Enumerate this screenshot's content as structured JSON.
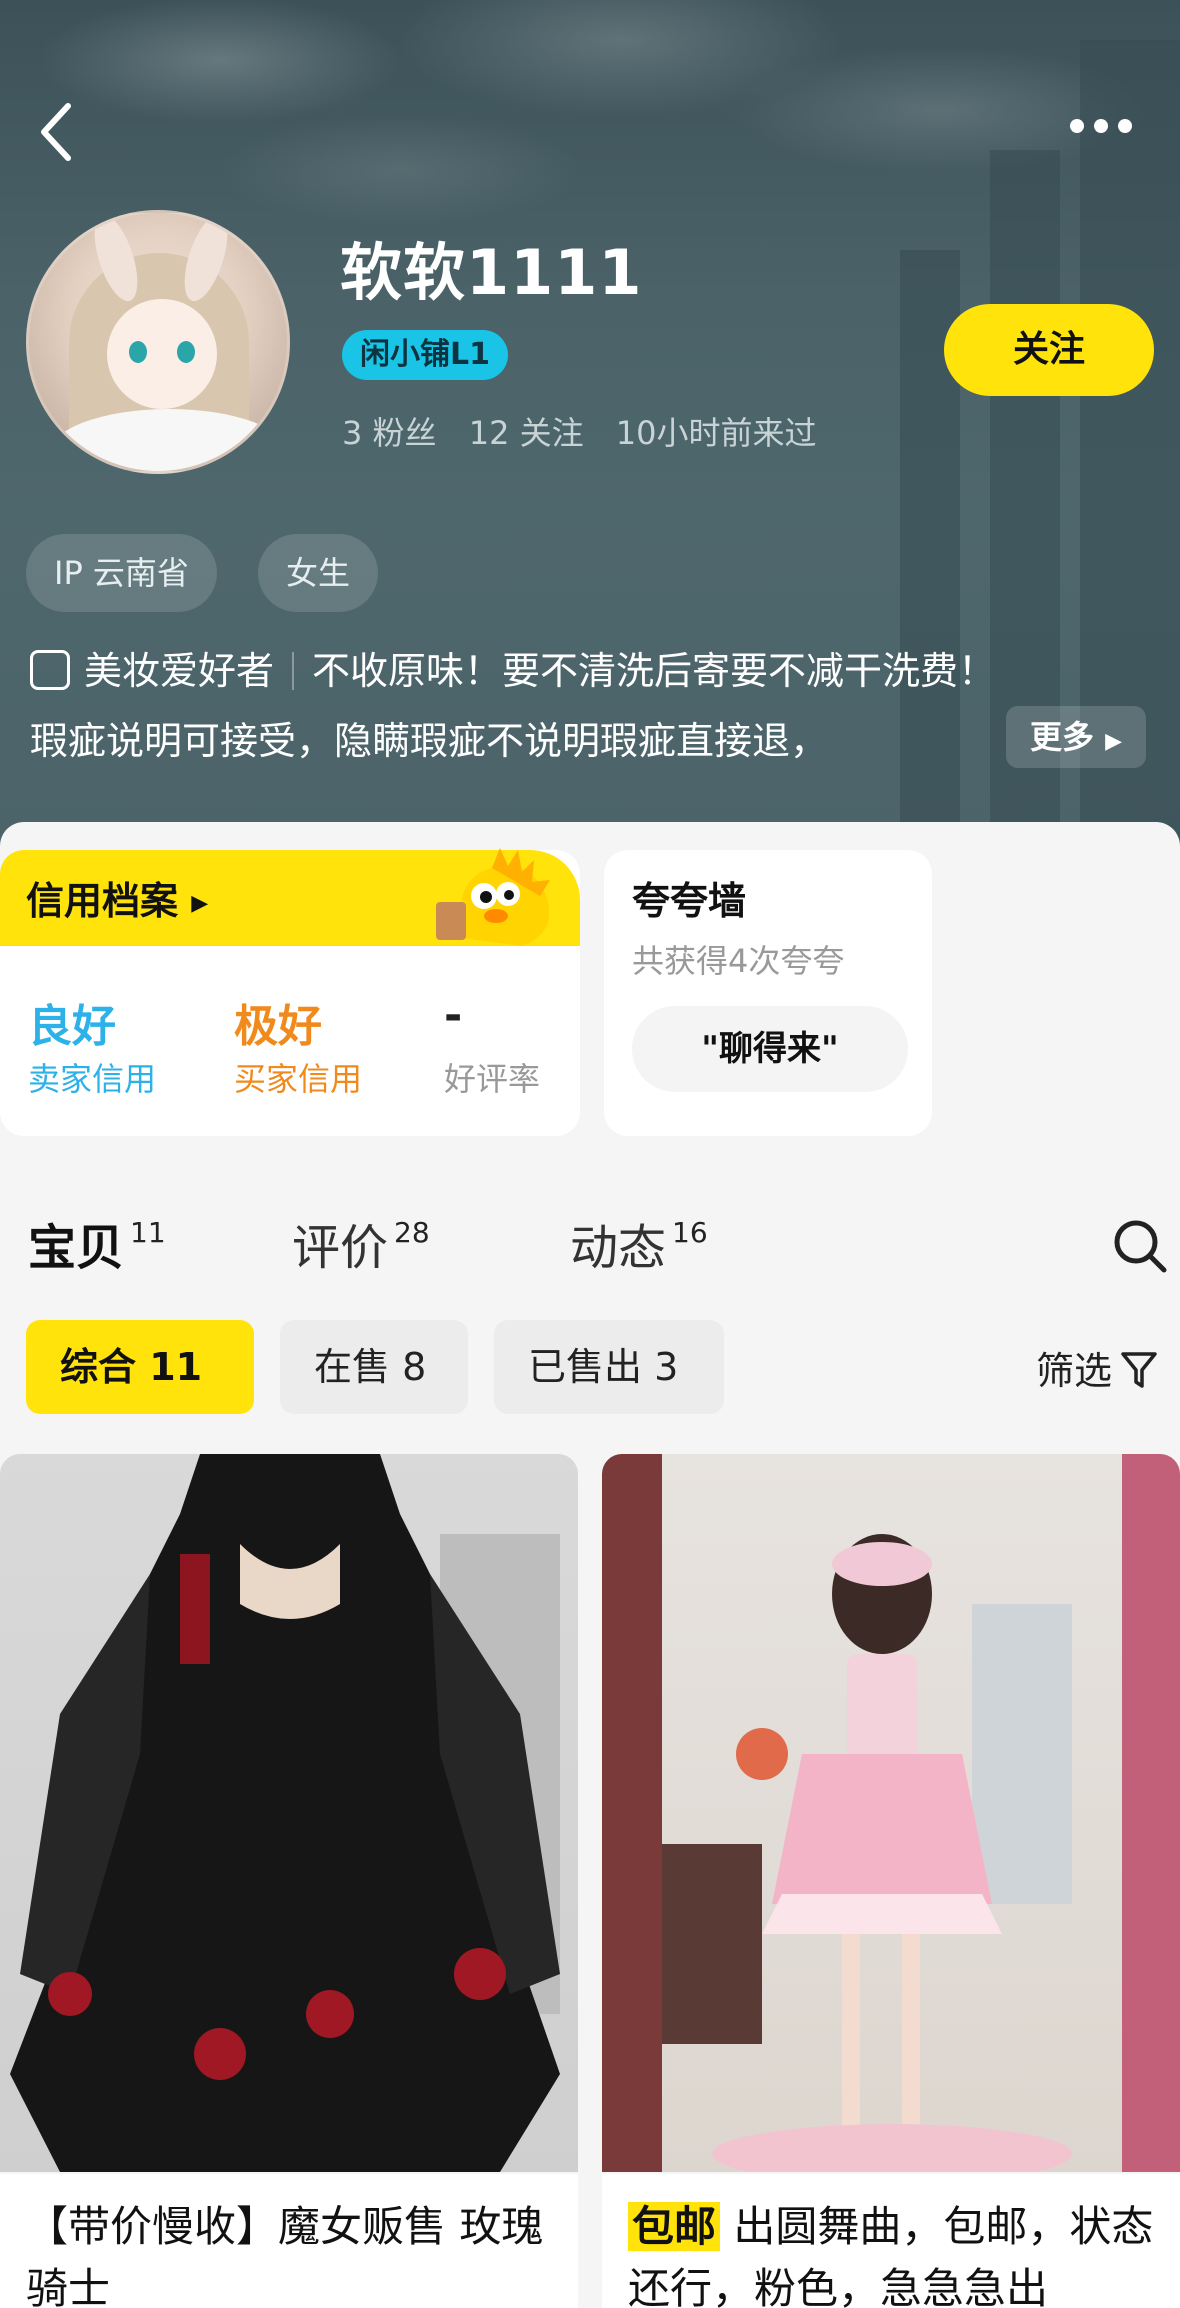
{
  "header": {
    "username": "软软1111",
    "level_badge": "闲小铺L1",
    "followers": "3 粉丝",
    "following": "12 关注",
    "last_seen": "10小时前来过",
    "follow_label": "关注",
    "tags": [
      "IP 云南省",
      "女生"
    ],
    "bio_category": "美妆爱好者",
    "bio_line1": "不收原味！要不清洗后寄要不减干洗费！",
    "bio_line2": "瑕疵说明可接受，隐瞒瑕疵不说明瑕疵直接退，",
    "more_label": "更多"
  },
  "credit": {
    "title": "信用档案",
    "items": [
      {
        "value": "良好",
        "label": "卖家信用",
        "color": "#2cb1e8"
      },
      {
        "value": "极好",
        "label": "买家信用",
        "color": "#f08a1c"
      },
      {
        "value": "-",
        "label": "好评率",
        "color": "#999999"
      }
    ]
  },
  "praise": {
    "title": "夸夸墙",
    "subtitle": "共获得4次夸夸",
    "chip": "\"聊得来\""
  },
  "tabs": [
    {
      "label": "宝贝",
      "count": "11"
    },
    {
      "label": "评价",
      "count": "28"
    },
    {
      "label": "动态",
      "count": "16"
    }
  ],
  "filters": {
    "chips": [
      "综合 11",
      "在售 8",
      "已售出 3"
    ],
    "filter_label": "筛选"
  },
  "products": [
    {
      "caption": "【带价慢收】魔女贩售 玫瑰骑士"
    },
    {
      "tag": "包邮",
      "caption": "出圆舞曲，包邮，状态还行，粉色，急急急出"
    }
  ],
  "colors": {
    "accent": "#ffe30a",
    "header_bg": "#4a6268",
    "badge": "#19c4e6"
  }
}
